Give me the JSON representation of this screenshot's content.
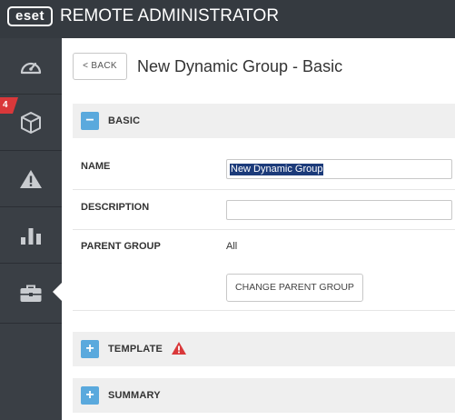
{
  "header": {
    "logo_text": "eset",
    "app_title": "REMOTE ADMINISTRATOR"
  },
  "sidebar": {
    "items": [
      {
        "name": "dashboard",
        "icon": "speedometer-icon"
      },
      {
        "name": "computers",
        "icon": "cube-icon",
        "badge": "4"
      },
      {
        "name": "threats",
        "icon": "warning-icon"
      },
      {
        "name": "reports",
        "icon": "bar-chart-icon"
      },
      {
        "name": "admin",
        "icon": "briefcase-icon",
        "active": true
      }
    ]
  },
  "main": {
    "back_label": "< BACK",
    "page_title": "New Dynamic Group - Basic",
    "sections": {
      "basic": {
        "toggle": "−",
        "title": "BASIC"
      },
      "template": {
        "toggle": "+",
        "title": "TEMPLATE"
      },
      "summary": {
        "toggle": "+",
        "title": "SUMMARY"
      }
    },
    "form": {
      "name_label": "NAME",
      "name_value": "New Dynamic Group",
      "description_label": "DESCRIPTION",
      "description_value": "",
      "parent_group_label": "PARENT GROUP",
      "parent_group_value": "All",
      "change_parent_button": "CHANGE PARENT GROUP"
    }
  },
  "colors": {
    "header_bg": "#353a40",
    "sidebar_bg": "#3a3f45",
    "accent_blue": "#5aa9dd",
    "badge_red": "#d9383a",
    "section_bg": "#efefef"
  }
}
